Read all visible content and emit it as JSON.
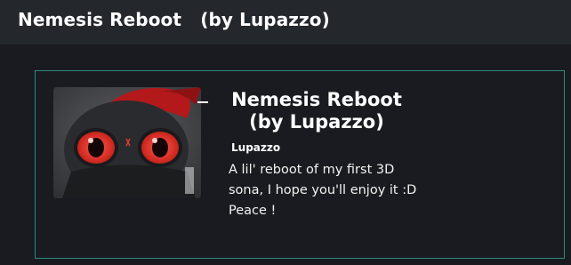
{
  "header": {
    "title": "Nemesis Reboot   (by Lupazzo)"
  },
  "card": {
    "title": "Nemesis Reboot\n(by Lupazzo)",
    "author": "Lupazzo",
    "description": "A lil' reboot of my first 3D sona, I hope you'll enjoy it :D Peace !",
    "thumbnail_icon": "avatar-thumbnail",
    "border_color": "#2c8a7e",
    "menu_icon": "minus-icon"
  }
}
